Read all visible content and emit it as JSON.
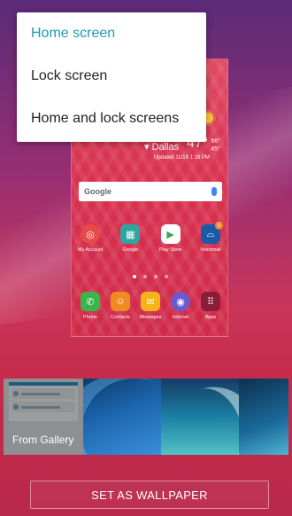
{
  "menu": {
    "items": [
      {
        "label": "Home screen",
        "active": true
      },
      {
        "label": "Lock screen",
        "active": false
      },
      {
        "label": "Home and lock screens",
        "active": false
      }
    ]
  },
  "preview": {
    "weather": {
      "city": "Dallas",
      "temp": "47°",
      "hi": "66°",
      "lo": "45°",
      "updated": "Updated  11/19  1:18 PM"
    },
    "search": {
      "logo": "Google"
    },
    "apps_row1": [
      {
        "label": "My Account",
        "color": "#e84a4a"
      },
      {
        "label": "Google",
        "color": "#2ea6a0"
      },
      {
        "label": "Play Store",
        "color": "#ffffff"
      },
      {
        "label": "Voicemail",
        "color": "#1a5aa8",
        "badge": "5"
      }
    ],
    "apps_row2": [
      {
        "label": "Phone",
        "color": "#39b54a"
      },
      {
        "label": "Contacts",
        "color": "#f28a22"
      },
      {
        "label": "Messages",
        "color": "#f6b318"
      },
      {
        "label": "Internet",
        "color": "#6a5acd"
      },
      {
        "label": "Apps",
        "color": "#8a1d3a"
      }
    ]
  },
  "gallery": {
    "label": "From Gallery"
  },
  "actions": {
    "set_wallpaper": "SET AS WALLPAPER"
  }
}
